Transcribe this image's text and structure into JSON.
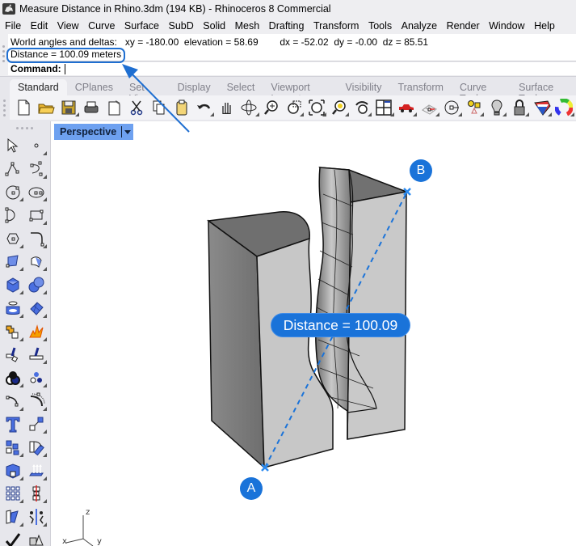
{
  "window": {
    "title": "Measure Distance in Rhino.3dm (194 KB) - Rhinoceros 8 Commercial",
    "icon": "rhino-logo-icon"
  },
  "menubar": {
    "items": [
      "File",
      "Edit",
      "View",
      "Curve",
      "Surface",
      "SubD",
      "Solid",
      "Mesh",
      "Drafting",
      "Transform",
      "Tools",
      "Analyze",
      "Render",
      "Window",
      "Help"
    ]
  },
  "command": {
    "history": [
      "World angles and deltas:   xy = -180.00  elevation = 58.69        dx = -52.02  dy = -0.00  dz = 85.51",
      "Distance = 100.09 meters"
    ],
    "prompt_label": "Command:",
    "input_value": ""
  },
  "toolbar": {
    "tabs": [
      {
        "label": "Standard",
        "active": true
      },
      {
        "label": "CPlanes",
        "active": false
      },
      {
        "label": "Set View",
        "active": false
      },
      {
        "label": "Display",
        "active": false
      },
      {
        "label": "Select",
        "active": false
      },
      {
        "label": "Viewport Layout",
        "active": false
      },
      {
        "label": "Visibility",
        "active": false
      },
      {
        "label": "Transform",
        "active": false
      },
      {
        "label": "Curve Tools",
        "active": false
      },
      {
        "label": "Surface Tools",
        "active": false
      }
    ],
    "icons": [
      "new-file-icon",
      "open-folder-icon",
      "save-icon",
      "print-icon",
      "import-icon",
      "cut-icon",
      "copy-icon",
      "paste-icon",
      "undo-icon",
      "pan-hand-icon",
      "rotate-view-icon",
      "zoom-icon",
      "zoom-window-icon",
      "zoom-extents-icon",
      "zoom-selected-icon",
      "undo-view-icon",
      "four-viewports-icon",
      "car-render-icon",
      "grid-snap-icon",
      "point-on-curve-icon",
      "object-props-icon",
      "light-bulb-icon",
      "lock-icon",
      "material-icon",
      "color-wheel-icon"
    ]
  },
  "side_toolbar": {
    "icons": [
      "select-arrow-icon",
      "point-icon",
      "polyline-icon",
      "curve-cv-icon",
      "circle-icon",
      "ellipse-icon",
      "arc-icon",
      "rectangle-icon",
      "polygon-icon",
      "fillet-curve-icon",
      "surface-corner-icon",
      "surface-edge-icon",
      "box-icon",
      "sphere-icon",
      "cylinder-icon",
      "surface-mesh-icon",
      "puzzle-icon",
      "explode-icon",
      "trim-icon",
      "split-icon",
      "boolean-union-icon",
      "boolean-points-icon",
      "offset-curve-icon",
      "offset-arc-icon",
      "text-icon",
      "scale-handle-icon",
      "group-icon",
      "rotate-icon",
      "solid-cap-icon",
      "extrude-icon",
      "array-icon",
      "align-icon",
      "mirror-icon",
      "flow-icon",
      "check-icon",
      "solid-primitives-icon"
    ]
  },
  "viewport": {
    "name": "Perspective",
    "distance_label": "Distance = 100.09",
    "point_a": "A",
    "point_b": "B",
    "axes": {
      "z": "z",
      "x": "x",
      "y": "y"
    }
  },
  "colors": {
    "accent": "#1a73d9",
    "viewport_tab": "#6ea1f0",
    "chrome": "#eeeef1"
  }
}
